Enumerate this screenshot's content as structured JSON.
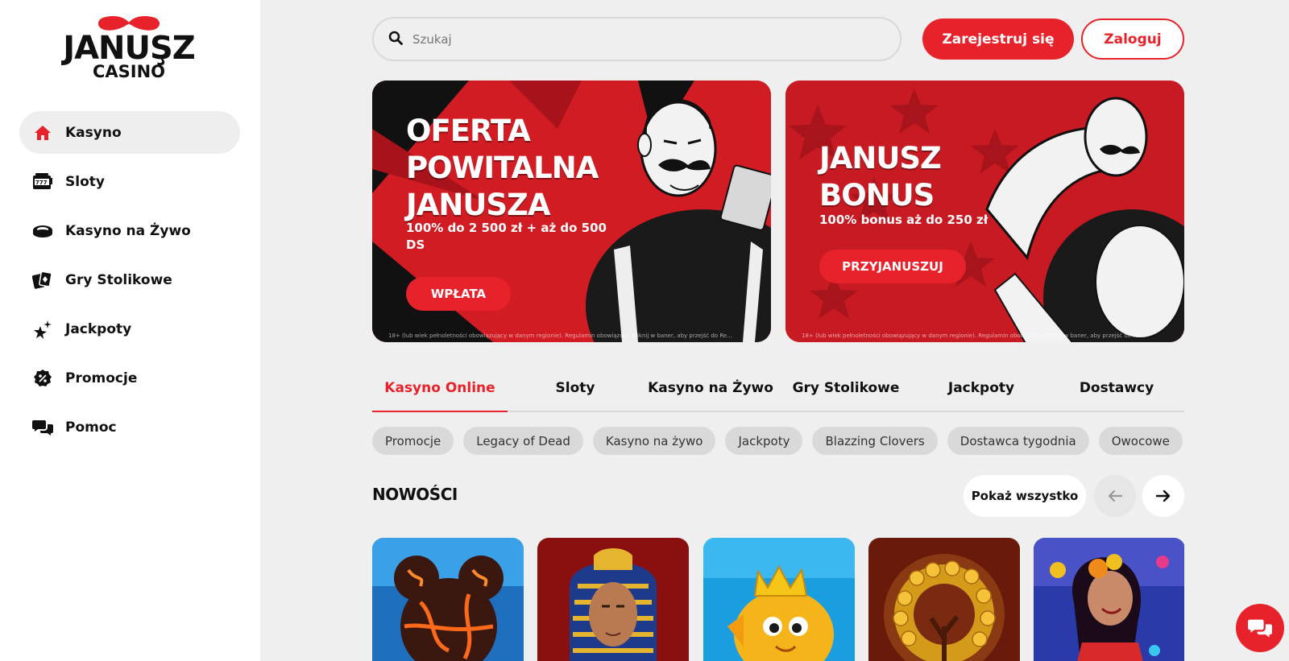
{
  "brand": {
    "name": "JANUŞZ",
    "sub": "CASINO",
    "accent": "#e8222b"
  },
  "sidebar": {
    "items": [
      {
        "label": "Kasyno",
        "icon": "home-icon",
        "active": true
      },
      {
        "label": "Sloty",
        "icon": "slot-machine-icon"
      },
      {
        "label": "Kasyno na Żywo",
        "icon": "roulette-chip-icon"
      },
      {
        "label": "Gry Stolikowe",
        "icon": "cards-icon"
      },
      {
        "label": "Jackpoty",
        "icon": "sparkle-star-icon"
      },
      {
        "label": "Promocje",
        "icon": "percent-badge-icon"
      },
      {
        "label": "Pomoc",
        "icon": "chat-bubbles-icon"
      }
    ]
  },
  "header": {
    "search_placeholder": "Szukaj",
    "register_label": "Zarejestruj się",
    "login_label": "Zaloguj"
  },
  "banners": [
    {
      "title_lines": [
        "OFERTA",
        "POWITALNA",
        "JANUSZA"
      ],
      "subtitle": "100% do 2 500 zł + aż do 500 DS",
      "cta": "WPŁATA",
      "disclaimer": "18+ (lub wiek pełnoletności obowiązujący w danym regionie). Regulamin obowiązuje. Kliknij w baner, aby przejść do Re..."
    },
    {
      "title_lines": [
        "JANUSZ",
        "BONUS"
      ],
      "subtitle": "100% bonus aż do 250 zł",
      "cta": "PRZYJANUSZUJ",
      "disclaimer": "18+ (lub wiek pełnoletności obowiązujący w danym regionie). Regulamin obowiązuje. Kliknij w baner, aby przejść do Re..."
    }
  ],
  "tabs": [
    {
      "label": "Kasyno Online",
      "active": true
    },
    {
      "label": "Sloty"
    },
    {
      "label": "Kasyno na Żywo"
    },
    {
      "label": "Gry Stolikowe"
    },
    {
      "label": "Jackpoty"
    },
    {
      "label": "Dostawcy"
    }
  ],
  "chips": [
    "Promocje",
    "Legacy of Dead",
    "Kasyno na żywo",
    "Jackpoty",
    "Blazzing Clovers",
    "Dostawca tygodnia",
    "Owocowe"
  ],
  "section": {
    "title": "NOWOŚCI",
    "show_all_label": "Pokaż wszystko"
  },
  "games": [
    {
      "icon": "lava-orb-game-thumbnail"
    },
    {
      "icon": "pharaoh-game-thumbnail"
    },
    {
      "icon": "golden-fish-king-game-thumbnail"
    },
    {
      "icon": "gold-coins-tree-game-thumbnail"
    },
    {
      "icon": "fiesta-dancer-game-thumbnail"
    }
  ]
}
